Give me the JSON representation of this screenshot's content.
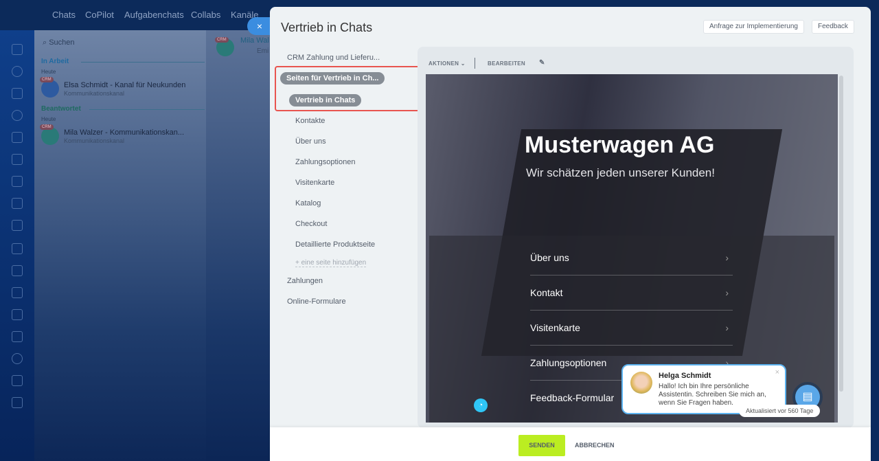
{
  "topbar": {
    "tabs": [
      "Chats",
      "CoPilot",
      "Aufgabenchats",
      "Collabs",
      "Kanäle"
    ]
  },
  "chatlist": {
    "search_placeholder": "Suchen",
    "sections": [
      {
        "label": "In Arbeit",
        "day": "Heute",
        "item": {
          "badge": "CRM",
          "title": "Elsa Schmidt - Kanal für Neukunden",
          "subtitle": "Kommunikationskanal"
        }
      },
      {
        "label": "Beantwortet",
        "day": "Heute",
        "item": {
          "badge": "CRM",
          "title": "Mila Walzer - Kommunikationskan...",
          "subtitle": "Kommunikationskanal"
        }
      }
    ]
  },
  "chat_header": {
    "badge": "CRM",
    "name": "Mila Wal",
    "sub": "Emi"
  },
  "panel": {
    "close": "×",
    "title": "Vertrieb in Chats",
    "buttons": {
      "implementation": "Anfrage zur Implementierung",
      "feedback": "Feedback"
    },
    "nav": {
      "crm": "CRM Zahlung und Lieferu...",
      "site": "Seiten für Vertrieb in Ch...",
      "active_page": "Vertrieb in Chats",
      "pages": [
        "Kontakte",
        "Über uns",
        "Zahlungsoptionen",
        "Visitenkarte",
        "Katalog",
        "Checkout",
        "Detaillierte Produktseite"
      ],
      "add_page": "+ eine seite hinzufügen",
      "payments": "Zahlungen",
      "forms": "Online-Formulare"
    },
    "toolbar": {
      "actions": "AKTIONEN",
      "edit": "BEARBEITEN"
    },
    "preview": {
      "brand": "Musterwagen AG",
      "tagline": "Wir schätzen jeden unserer Kunden!",
      "menu": [
        "Über uns",
        "Kontakt",
        "Visitenkarte",
        "Zahlungsoptionen",
        "Feedback-Formular"
      ]
    },
    "widget": {
      "name": "Helga Schmidt",
      "message": "Hallo! Ich bin Ihre persönliche Assistentin. Schreiben Sie mich an, wenn Sie Fragen haben.",
      "updated": "Aktualisiert vor 560 Tage"
    },
    "footer": {
      "send": "SENDEN",
      "cancel": "ABBRECHEN"
    }
  }
}
